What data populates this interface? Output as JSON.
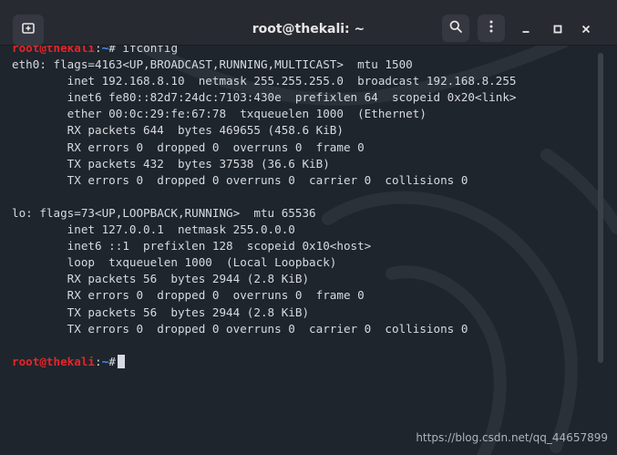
{
  "window": {
    "title": "root@thekali: ~"
  },
  "prompt": {
    "user": "root@thekali",
    "sep": ":",
    "path": "~",
    "symbol": "#"
  },
  "command": "ifconfig",
  "output_lines": [
    "eth0: flags=4163<UP,BROADCAST,RUNNING,MULTICAST>  mtu 1500",
    "        inet 192.168.8.10  netmask 255.255.255.0  broadcast 192.168.8.255",
    "        inet6 fe80::82d7:24dc:7103:430e  prefixlen 64  scopeid 0x20<link>",
    "        ether 00:0c:29:fe:67:78  txqueuelen 1000  (Ethernet)",
    "        RX packets 644  bytes 469655 (458.6 KiB)",
    "        RX errors 0  dropped 0  overruns 0  frame 0",
    "        TX packets 432  bytes 37538 (36.6 KiB)",
    "        TX errors 0  dropped 0 overruns 0  carrier 0  collisions 0",
    "",
    "lo: flags=73<UP,LOOPBACK,RUNNING>  mtu 65536",
    "        inet 127.0.0.1  netmask 255.0.0.0",
    "        inet6 ::1  prefixlen 128  scopeid 0x10<host>",
    "        loop  txqueuelen 1000  (Local Loopback)",
    "        RX packets 56  bytes 2944 (2.8 KiB)",
    "        RX errors 0  dropped 0  overruns 0  frame 0",
    "        TX packets 56  bytes 2944 (2.8 KiB)",
    "        TX errors 0  dropped 0 overruns 0  carrier 0  collisions 0",
    ""
  ],
  "watermark": "https://blog.csdn.net/qq_44657899",
  "icons": {
    "new_tab": "new-tab-icon",
    "search": "search-icon",
    "menu": "kebab-menu-icon",
    "minimize": "minimize-icon",
    "maximize": "maximize-icon",
    "close": "close-icon"
  },
  "colors": {
    "prompt_user": "#e5252a",
    "prompt_path": "#4a90ff",
    "text": "#d7dadf",
    "background": "#1f252c",
    "titlebar": "#272a31"
  }
}
